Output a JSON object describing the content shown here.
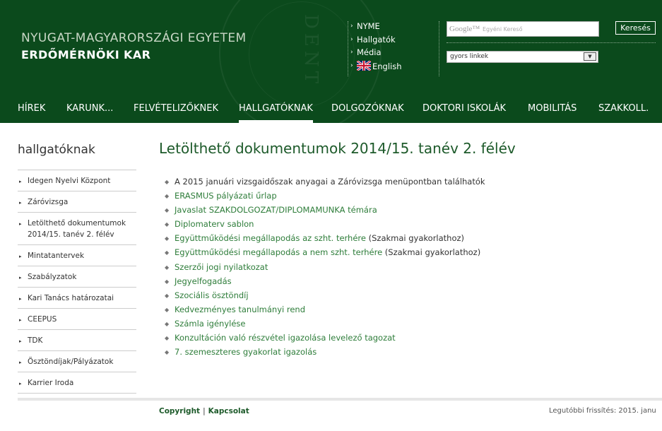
{
  "header": {
    "university": "NYUGAT-MAGYARORSZÁGI EGYETEM",
    "faculty": "ERDŐMÉRNÖKI KAR",
    "top_links": [
      "NYME",
      "Hallgatók",
      "Média",
      "English"
    ],
    "search": {
      "google_label": "Google™",
      "placeholder": "Egyéni Kereső",
      "button": "Keresés"
    },
    "quick_links": {
      "selected": "gyors linkek"
    }
  },
  "nav": {
    "items": [
      "HÍREK",
      "KARUNK...",
      "FELVÉTELIZŐKNEK",
      "HALLGATÓKNAK",
      "DOLGOZÓKNAK",
      "DOKTORI ISKOLÁK",
      "MOBILITÁS",
      "SZAKKOLL."
    ],
    "active": "HALLGATÓKNAK"
  },
  "sidebar": {
    "title": "hallgatóknak",
    "items": [
      "Idegen Nyelvi Központ",
      "Záróvizsga",
      "Letölthető dokumentumok 2014/15. tanév 2. félév",
      "Mintatantervek",
      "Szabályzatok",
      "Kari Tanács határozatai",
      "CEEPUS",
      "TDK",
      "Ösztöndíjak/Pályázatok",
      "Karrier Iroda"
    ]
  },
  "main": {
    "title": "Letölthető dokumentumok 2014/15. tanév 2. félév",
    "docs": [
      {
        "text": "A 2015 januári vizsgaidőszak anyagai a Záróvizsga menüpontban találhatók",
        "suffix": ""
      },
      {
        "text": "ERASMUS pályázati űrlap",
        "suffix": ""
      },
      {
        "text": "Javaslat SZAKDOLGOZAT/DIPLOMAMUNKA témára",
        "suffix": ""
      },
      {
        "text": "Diplomaterv sablon",
        "suffix": ""
      },
      {
        "text": "Együttműködési megállapodás az szht. terhére",
        "suffix": " (Szakmai gyakorlathoz)"
      },
      {
        "text": "Együttműködési megállapodás a nem szht. terhére",
        "suffix": " (Szakmai gyakorlathoz)"
      },
      {
        "text": "Szerzői jogi nyilatkozat",
        "suffix": ""
      },
      {
        "text": "Jegyelfogadás",
        "suffix": ""
      },
      {
        "text": "Szociális ösztöndíj",
        "suffix": ""
      },
      {
        "text": "Kedvezményes tanulmányi rend",
        "suffix": ""
      },
      {
        "text": "Számla igénylése",
        "suffix": ""
      },
      {
        "text": "Konzultáción való részvétel igazolása levelező tagozat",
        "suffix": ""
      },
      {
        "text": "7. szemeszteres gyakorlat igazolás",
        "suffix": ""
      }
    ]
  },
  "footer": {
    "copyright": "Copyright",
    "contact": "Kapcsolat",
    "update": "Legutóbbi frissítés: 2015. janu"
  },
  "colors": {
    "header_green": "#0b4a1c",
    "link_green": "#2e7d3a",
    "title_green": "#1d5a2a"
  }
}
